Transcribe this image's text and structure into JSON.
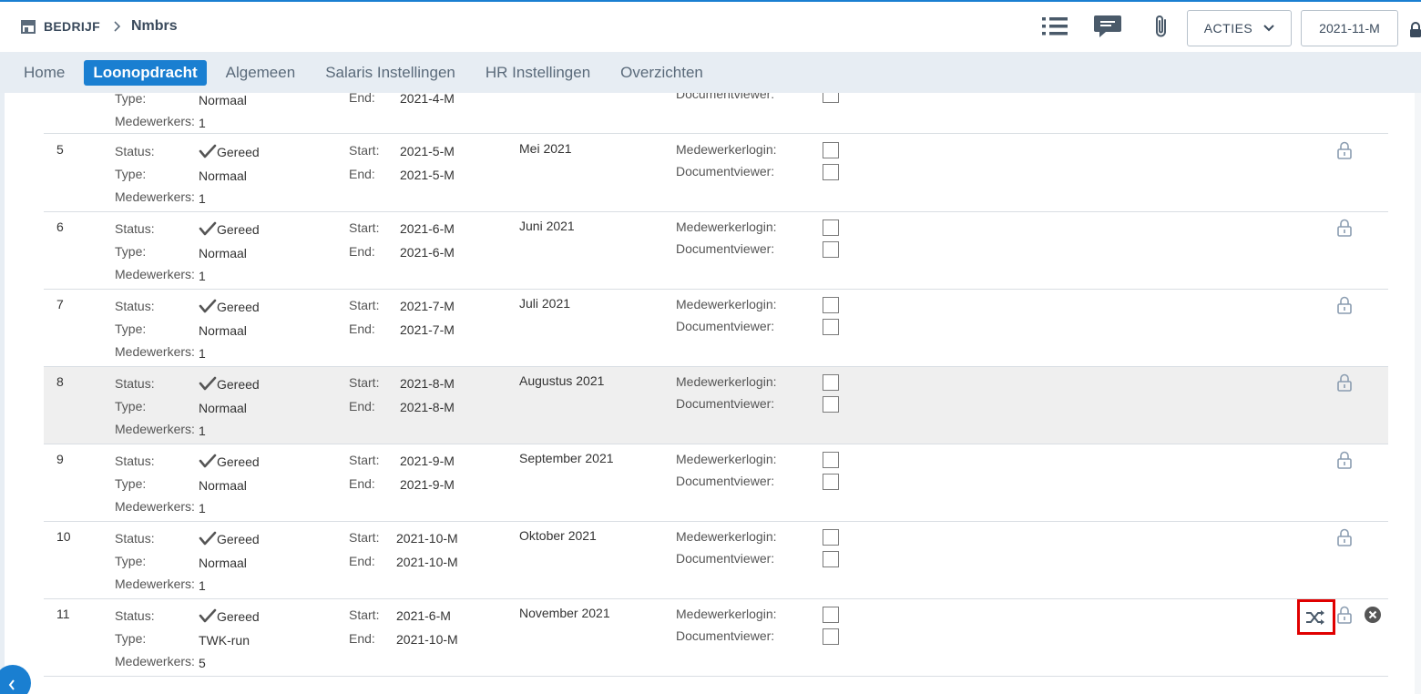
{
  "header": {
    "company": "BEDRIJF",
    "name": "Nmbrs",
    "acties_label": "ACTIES",
    "period_label": "2021-11-M"
  },
  "nav": {
    "items": [
      "Home",
      "Loonopdracht",
      "Algemeen",
      "Salaris Instellingen",
      "HR Instellingen",
      "Overzichten"
    ],
    "active": "Loonopdracht"
  },
  "labels": {
    "status": "Status:",
    "type": "Type:",
    "medewerkers": "Medewerkers:",
    "start": "Start:",
    "end": "End:",
    "medewerkerlogin": "Medewerkerlogin:",
    "documentviewer": "Documentviewer:"
  },
  "partial_row": {
    "type": "Normaal",
    "medewerkers": "1",
    "end": "2021-4-M"
  },
  "runs": [
    {
      "num": "5",
      "status": "Gereed",
      "type": "Normaal",
      "medewerkers": "1",
      "start": "2021-5-M",
      "end": "2021-5-M",
      "period": "Mei 2021"
    },
    {
      "num": "6",
      "status": "Gereed",
      "type": "Normaal",
      "medewerkers": "1",
      "start": "2021-6-M",
      "end": "2021-6-M",
      "period": "Juni 2021"
    },
    {
      "num": "7",
      "status": "Gereed",
      "type": "Normaal",
      "medewerkers": "1",
      "start": "2021-7-M",
      "end": "2021-7-M",
      "period": "Juli 2021"
    },
    {
      "num": "8",
      "status": "Gereed",
      "type": "Normaal",
      "medewerkers": "1",
      "start": "2021-8-M",
      "end": "2021-8-M",
      "period": "Augustus 2021"
    },
    {
      "num": "9",
      "status": "Gereed",
      "type": "Normaal",
      "medewerkers": "1",
      "start": "2021-9-M",
      "end": "2021-9-M",
      "period": "September 2021"
    },
    {
      "num": "10",
      "status": "Gereed",
      "type": "Normaal",
      "medewerkers": "1",
      "start": "2021-10-M",
      "end": "2021-10-M",
      "period": "Oktober 2021"
    },
    {
      "num": "11",
      "status": "Gereed",
      "type": "TWK-run",
      "medewerkers": "5",
      "start": "2021-6-M",
      "end": "2021-10-M",
      "period": "November 2021"
    }
  ],
  "icons": {
    "brand_blue": "#1a7fd1",
    "lock_color": "#8a9cb0",
    "highlight_color": "#e00000"
  }
}
